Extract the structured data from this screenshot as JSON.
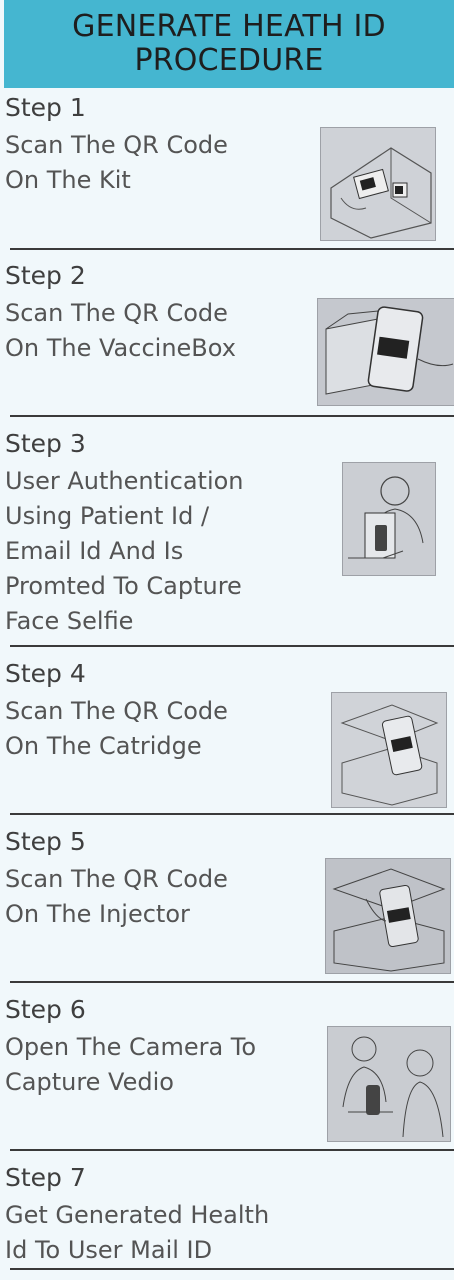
{
  "header": {
    "title_line1": "GENERATE HEATH ID",
    "title_line2": "PROCEDURE"
  },
  "steps": [
    {
      "title": "Step 1",
      "lines": [
        "Scan The QR Code",
        "On The Kit"
      ],
      "illustration_icon": "qr-scan-kit-icon"
    },
    {
      "title": "Step 2",
      "lines": [
        "Scan The QR Code",
        "On The VaccineBox"
      ],
      "illustration_icon": "qr-scan-vaccine-box-icon"
    },
    {
      "title": "Step 3",
      "lines": [
        "User Authentication",
        "Using Patient Id /",
        "Email Id And Is",
        "Promted To Capture",
        "Face Selfie"
      ],
      "illustration_icon": "face-selfie-icon"
    },
    {
      "title": "Step 4",
      "lines": [
        "Scan The QR Code",
        "On The Catridge"
      ],
      "illustration_icon": "qr-scan-cartridge-icon"
    },
    {
      "title": "Step 5",
      "lines": [
        "Scan The QR Code",
        "On The Injector"
      ],
      "illustration_icon": "qr-scan-injector-icon"
    },
    {
      "title": "Step 6",
      "lines": [
        "Open The Camera To",
        "Capture Vedio"
      ],
      "illustration_icon": "camera-video-icon"
    },
    {
      "title": "Step 7",
      "lines": [
        "Get Generated Health",
        "Id To User Mail ID"
      ],
      "illustration_icon": ""
    }
  ]
}
